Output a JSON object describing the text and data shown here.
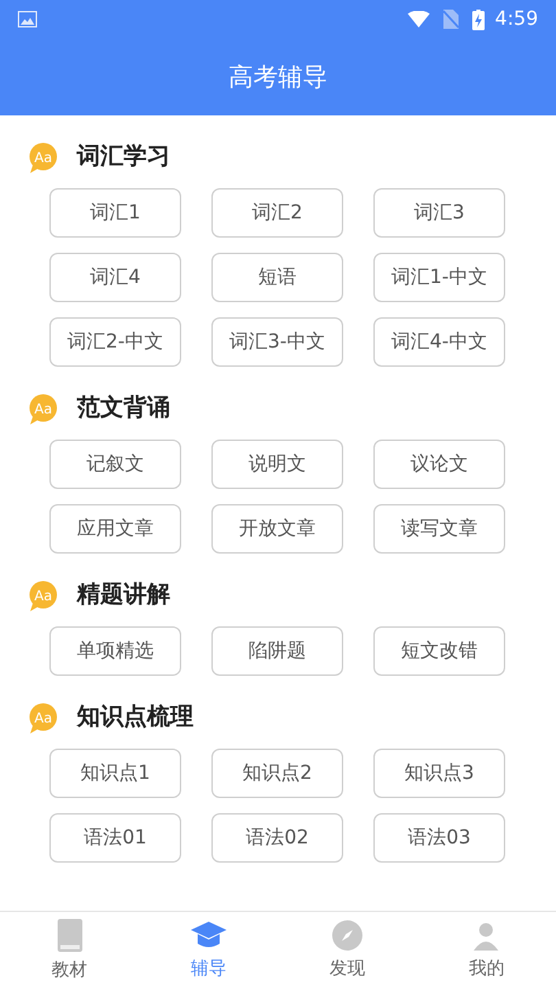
{
  "status_bar": {
    "time": "4:59"
  },
  "title": "高考辅导",
  "sections": [
    {
      "title": "词汇学习",
      "icon_text": "Aa",
      "items": [
        "词汇1",
        "词汇2",
        "词汇3",
        "词汇4",
        "短语",
        "词汇1-中文",
        "词汇2-中文",
        "词汇3-中文",
        "词汇4-中文"
      ]
    },
    {
      "title": "范文背诵",
      "icon_text": "Aa",
      "items": [
        "记叙文",
        "说明文",
        "议论文",
        "应用文章",
        "开放文章",
        "读写文章"
      ]
    },
    {
      "title": "精题讲解",
      "icon_text": "Aa",
      "items": [
        "单项精选",
        "陷阱题",
        "短文改错"
      ]
    },
    {
      "title": "知识点梳理",
      "icon_text": "Aa",
      "items": [
        "知识点1",
        "知识点2",
        "知识点3",
        "语法01",
        "语法02",
        "语法03"
      ]
    }
  ],
  "tabs": [
    {
      "label": "教材",
      "kind": "book",
      "selected": false
    },
    {
      "label": "辅导",
      "kind": "cap",
      "selected": true
    },
    {
      "label": "发现",
      "kind": "compass",
      "selected": false
    },
    {
      "label": "我的",
      "kind": "user",
      "selected": false
    }
  ]
}
